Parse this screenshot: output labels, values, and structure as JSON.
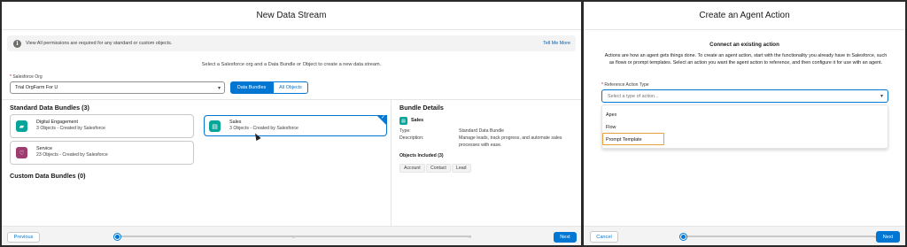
{
  "left": {
    "title": "New Data Stream",
    "info": {
      "text": "View All permissions are required for any standard or custom objects.",
      "link": "Tell Me More"
    },
    "instruction": "Select a Salesforce org and a Data Bundle or Object to create a new data stream.",
    "org": {
      "required": "*",
      "label": "Salesforce Org",
      "value": "Trial OrgFarm For U"
    },
    "toggle": {
      "active": "Data Bundles",
      "inactive": "All Objects"
    },
    "standard_heading": "Standard Data Bundles (3)",
    "custom_heading": "Custom Data Bundles (0)",
    "cards": {
      "digital": {
        "title": "Digital Engagement",
        "sub": "3 Objects - Created by Salesforce",
        "color": "#06a59a"
      },
      "service": {
        "title": "Service",
        "sub": "23 Objects - Created by Salesforce",
        "color": "#9e3c6d"
      },
      "sales": {
        "title": "Sales",
        "sub": "3 Objects - Created by Salesforce",
        "color": "#06a59a",
        "selected": true
      }
    },
    "bundle": {
      "heading": "Bundle Details",
      "name": "Sales",
      "type_key": "Type:",
      "type_val": "Standard Data Bundle",
      "desc_key": "Description:",
      "desc_val": "Manage leads, track progress, and automate sales processes with ease.",
      "objects_heading": "Objects Included (3)",
      "objects": [
        "Account",
        "Contact",
        "Lead"
      ]
    },
    "footer": {
      "previous": "Previous",
      "next": "Next"
    }
  },
  "right": {
    "title": "Create an Agent Action",
    "heading": "Connect an existing action",
    "description": "Actions are how an agent gets things done. To create an agent action, start with the functionality you already have in Salesforce, such as flows or prompt templates. Select an action you want the agent action to reference, and then configure it for use with an agent.",
    "field": {
      "required": "*",
      "label": "Reference Action Type",
      "placeholder": "Select a type of action..."
    },
    "options": [
      "Apex",
      "Flow",
      "Prompt Template"
    ],
    "highlighted_option": "Prompt Template",
    "footer": {
      "cancel": "Cancel",
      "next": "Next"
    }
  },
  "colors": {
    "brand": "#0176d3",
    "highlight": "#e8a03b"
  }
}
